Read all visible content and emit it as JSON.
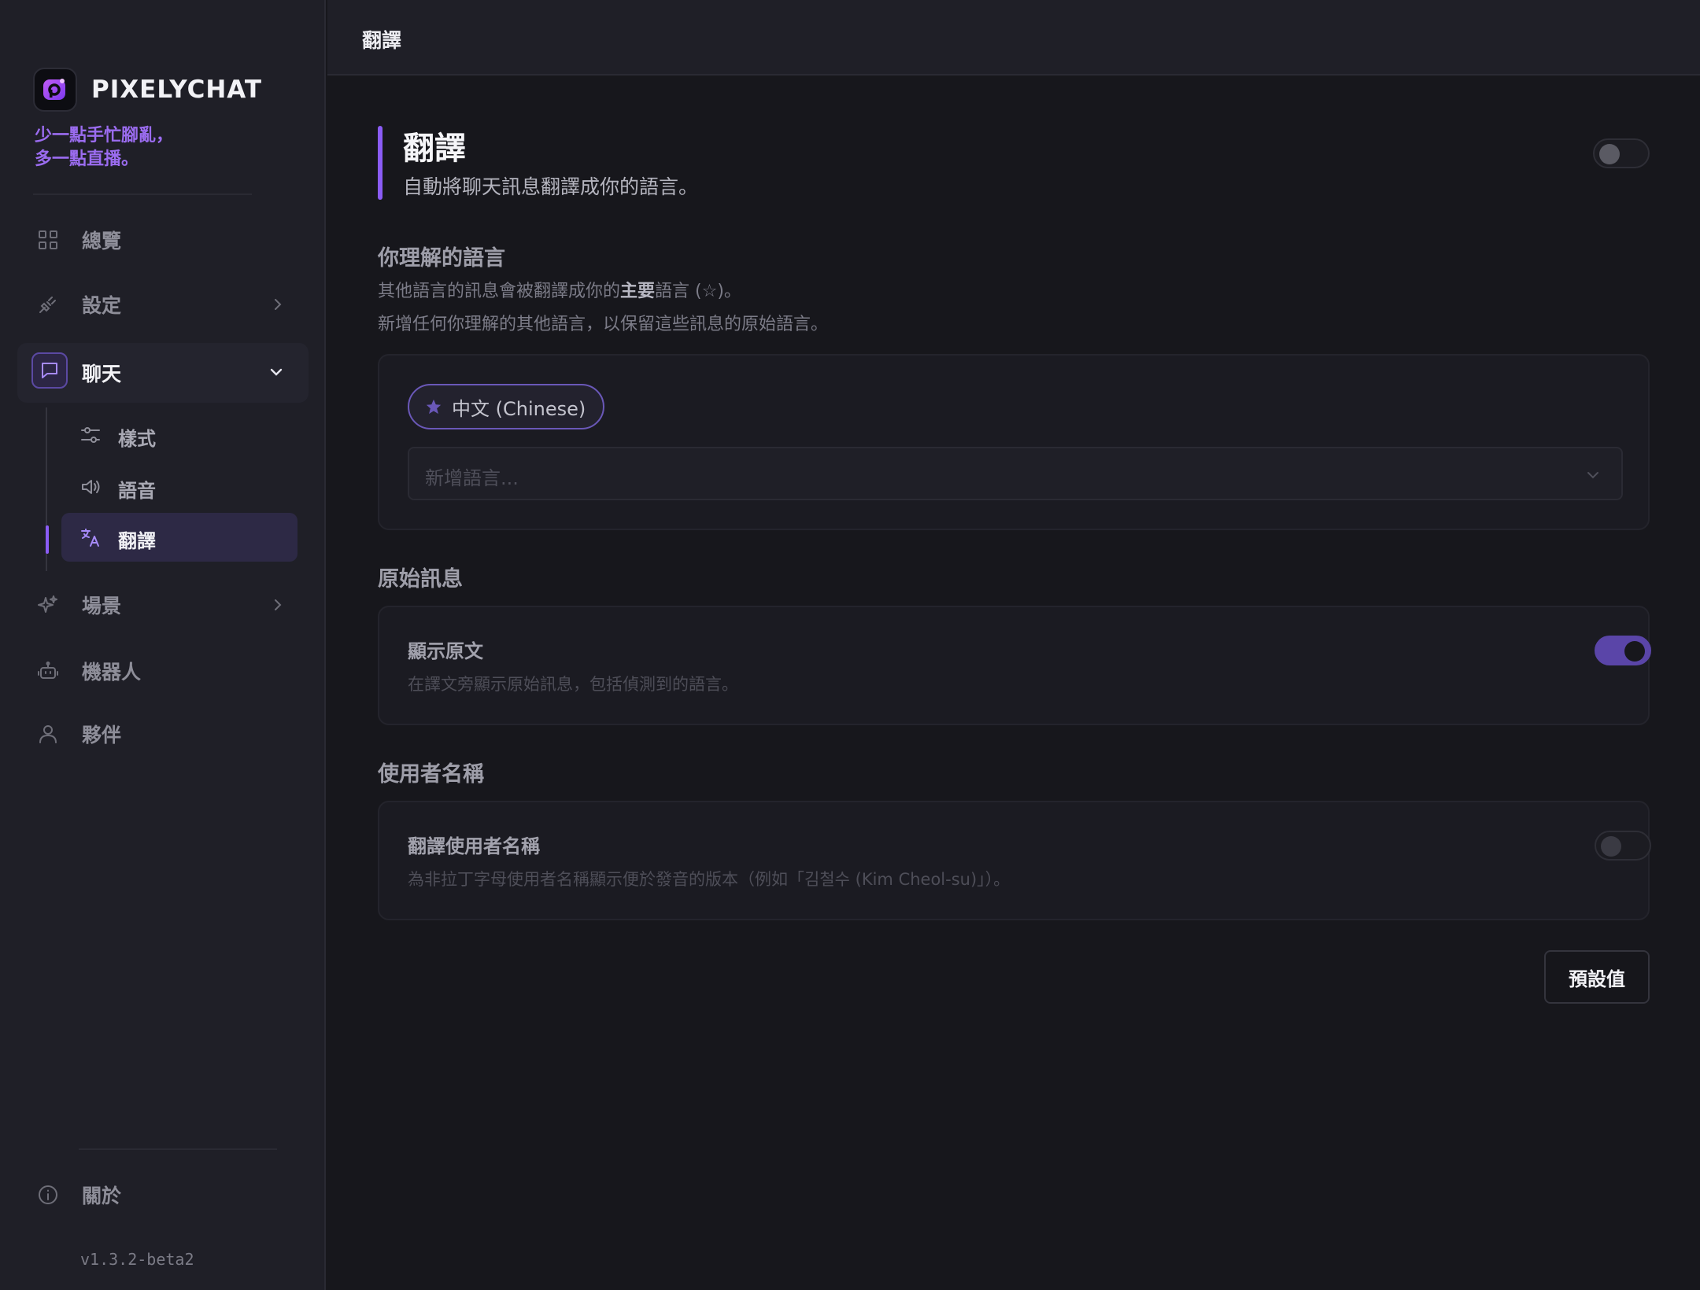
{
  "app": {
    "name": "PIXELYCHAT",
    "tagline_line1": "少一點手忙腳亂，",
    "tagline_line2": "多一點直播。",
    "version": "v1.3.2-beta2"
  },
  "sidebar": {
    "items": [
      {
        "label": "總覽",
        "icon": "grid-icon"
      },
      {
        "label": "設定",
        "icon": "plug-icon"
      },
      {
        "label": "聊天",
        "icon": "chat-icon"
      },
      {
        "label": "場景",
        "icon": "sparkle-icon"
      },
      {
        "label": "機器人",
        "icon": "robot-icon"
      },
      {
        "label": "夥伴",
        "icon": "user-icon"
      }
    ],
    "chat_subitems": [
      {
        "label": "樣式",
        "icon": "sliders-icon"
      },
      {
        "label": "語音",
        "icon": "speaker-icon"
      },
      {
        "label": "翻譯",
        "icon": "translate-icon"
      }
    ],
    "about": {
      "label": "關於",
      "icon": "info-icon"
    }
  },
  "header": {
    "title": "翻譯"
  },
  "main": {
    "title": "翻譯",
    "description": "自動將聊天訊息翻譯成你的語言。",
    "enabled": false,
    "languages": {
      "title": "你理解的語言",
      "desc1_pre": "其他語言的訊息會被翻譯成你的",
      "desc1_bold": "主要",
      "desc1_post": "語言 (☆)。",
      "desc2": "新增任何你理解的其他語言，以保留這些訊息的原始語言。",
      "primary_language": "中文 (Chinese)",
      "add_placeholder": "新增語言..."
    },
    "original": {
      "title": "原始訊息",
      "row_title": "顯示原文",
      "row_desc": "在譯文旁顯示原始訊息，包括偵測到的語言。",
      "enabled": true
    },
    "usernames": {
      "title": "使用者名稱",
      "row_title": "翻譯使用者名稱",
      "row_desc": "為非拉丁字母使用者名稱顯示便於發音的版本（例如「김철수 (Kim Cheol-su)」）。",
      "enabled": false
    },
    "reset_button": "預設值"
  },
  "colors": {
    "accent": "#8b5cf6",
    "tagline": "#9b6cf0",
    "toggle_on": "#5a45a8"
  }
}
